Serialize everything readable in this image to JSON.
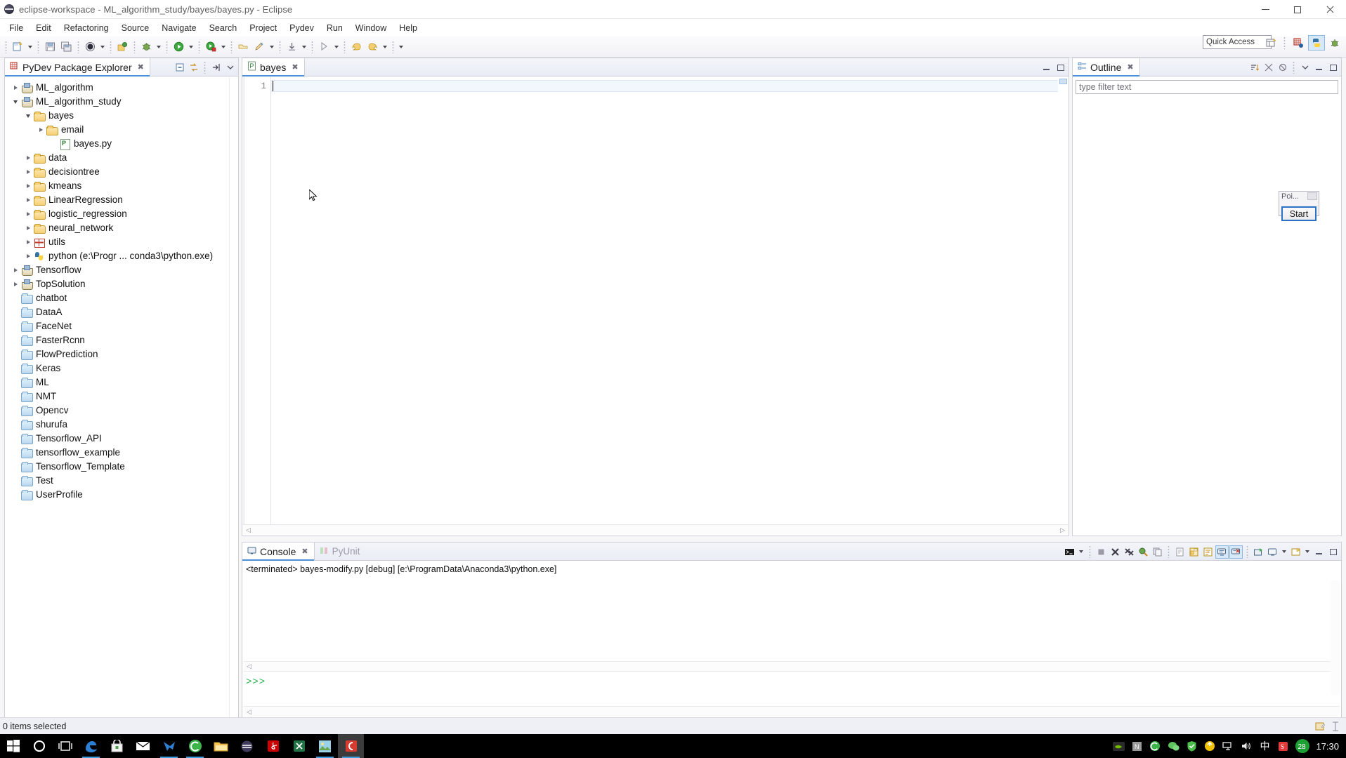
{
  "window": {
    "title": "eclipse-workspace - ML_algorithm_study/bayes/bayes.py - Eclipse",
    "app_icon": "eclipse-icon",
    "minimize": "minimize-icon",
    "maximize": "maximize-icon",
    "close": "close-icon"
  },
  "menubar": {
    "items": [
      {
        "label": "File"
      },
      {
        "label": "Edit"
      },
      {
        "label": "Refactoring"
      },
      {
        "label": "Source"
      },
      {
        "label": "Navigate"
      },
      {
        "label": "Search"
      },
      {
        "label": "Project"
      },
      {
        "label": "Pydev"
      },
      {
        "label": "Run"
      },
      {
        "label": "Window"
      },
      {
        "label": "Help"
      }
    ]
  },
  "toolbar": {
    "quick_access_placeholder": "Quick Access",
    "buttons": [
      {
        "name": "new-wizard-icon"
      },
      {
        "name": "save-icon"
      },
      {
        "name": "save-all-icon"
      },
      {
        "name": "print-icon"
      },
      {
        "name": "debug-icon"
      },
      {
        "name": "external-tools-icon"
      },
      {
        "name": "run-icon"
      },
      {
        "name": "coverage-icon"
      },
      {
        "name": "open-type-icon"
      },
      {
        "name": "pin-editor-icon"
      },
      {
        "name": "previous-annotation-icon"
      },
      {
        "name": "next-annotation-icon"
      },
      {
        "name": "back-icon"
      },
      {
        "name": "forward-icon"
      }
    ],
    "perspective": [
      {
        "name": "open-perspective-icon"
      },
      {
        "name": "java-perspective-icon"
      },
      {
        "name": "pydev-perspective-icon"
      },
      {
        "name": "debug-perspective-icon"
      }
    ]
  },
  "explorer": {
    "title": "PyDev Package Explorer",
    "title_icon": "package-explorer-icon",
    "close_icon": "close-icon",
    "view_tools": [
      {
        "name": "collapse-all-icon"
      },
      {
        "name": "link-with-editor-icon"
      },
      {
        "name": "focus-on-active-task-icon"
      },
      {
        "name": "view-menu-icon"
      }
    ],
    "minimize_icon": "minimize-icon",
    "maximize_icon": "maximize-icon",
    "tree": [
      {
        "label": "ML_algorithm",
        "icon": "project-icon",
        "indent": 0,
        "state": "collapsed"
      },
      {
        "label": "ML_algorithm_study",
        "icon": "project-icon",
        "indent": 0,
        "state": "expanded"
      },
      {
        "label": "bayes",
        "icon": "folder-icon",
        "indent": 1,
        "state": "expanded"
      },
      {
        "label": "email",
        "icon": "folder-icon",
        "indent": 2,
        "state": "collapsed"
      },
      {
        "label": "bayes.py",
        "icon": "python-file-icon",
        "indent": 3,
        "state": "leaf"
      },
      {
        "label": "data",
        "icon": "folder-icon",
        "indent": 1,
        "state": "collapsed"
      },
      {
        "label": "decisiontree",
        "icon": "folder-icon",
        "indent": 1,
        "state": "collapsed"
      },
      {
        "label": "kmeans",
        "icon": "folder-icon",
        "indent": 1,
        "state": "collapsed"
      },
      {
        "label": "LinearRegression",
        "icon": "folder-icon",
        "indent": 1,
        "state": "collapsed"
      },
      {
        "label": "logistic_regression",
        "icon": "folder-icon",
        "indent": 1,
        "state": "collapsed"
      },
      {
        "label": "neural_network",
        "icon": "folder-icon",
        "indent": 1,
        "state": "collapsed"
      },
      {
        "label": "utils",
        "icon": "grid-icon",
        "indent": 1,
        "state": "collapsed"
      },
      {
        "label": "python  (e:\\Progr ... conda3\\python.exe)",
        "icon": "python-interpreter-icon",
        "indent": 1,
        "state": "collapsed"
      },
      {
        "label": "Tensorflow",
        "icon": "project-icon",
        "indent": 0,
        "state": "collapsed"
      },
      {
        "label": "TopSolution",
        "icon": "project-icon",
        "indent": 0,
        "state": "collapsed"
      },
      {
        "label": "chatbot",
        "icon": "closed-folder-icon",
        "indent": 0,
        "state": "leaf"
      },
      {
        "label": "DataA",
        "icon": "closed-folder-icon",
        "indent": 0,
        "state": "leaf"
      },
      {
        "label": "FaceNet",
        "icon": "closed-folder-icon",
        "indent": 0,
        "state": "leaf"
      },
      {
        "label": "FasterRcnn",
        "icon": "closed-folder-icon",
        "indent": 0,
        "state": "leaf"
      },
      {
        "label": "FlowPrediction",
        "icon": "closed-folder-icon",
        "indent": 0,
        "state": "leaf"
      },
      {
        "label": "Keras",
        "icon": "closed-folder-icon",
        "indent": 0,
        "state": "leaf"
      },
      {
        "label": "ML",
        "icon": "closed-folder-icon",
        "indent": 0,
        "state": "leaf"
      },
      {
        "label": "NMT",
        "icon": "closed-folder-icon",
        "indent": 0,
        "state": "leaf"
      },
      {
        "label": "Opencv",
        "icon": "closed-folder-icon",
        "indent": 0,
        "state": "leaf"
      },
      {
        "label": "shurufa",
        "icon": "closed-folder-icon",
        "indent": 0,
        "state": "leaf"
      },
      {
        "label": "Tensorflow_API",
        "icon": "closed-folder-icon",
        "indent": 0,
        "state": "leaf"
      },
      {
        "label": "tensorflow_example",
        "icon": "closed-folder-icon",
        "indent": 0,
        "state": "leaf"
      },
      {
        "label": "Tensorflow_Template",
        "icon": "closed-folder-icon",
        "indent": 0,
        "state": "leaf"
      },
      {
        "label": "Test",
        "icon": "closed-folder-icon",
        "indent": 0,
        "state": "leaf"
      },
      {
        "label": "UserProfile",
        "icon": "closed-folder-icon",
        "indent": 0,
        "state": "leaf"
      }
    ]
  },
  "editor": {
    "tab_label": "bayes",
    "tab_icon": "python-file-icon",
    "tab_close": "close-icon",
    "line_numbers": [
      "1"
    ],
    "content": "",
    "minimize_icon": "minimize-icon",
    "maximize_icon": "maximize-icon"
  },
  "outline": {
    "title": "Outline",
    "title_icon": "outline-icon",
    "close_icon": "close-icon",
    "filter_placeholder": "type filter text",
    "tools": [
      {
        "name": "sort-icon"
      },
      {
        "name": "hide-fields-icon"
      },
      {
        "name": "hide-static-icon"
      },
      {
        "name": "hide-nonpublic-icon"
      },
      {
        "name": "view-menu-icon"
      }
    ],
    "minimize_icon": "minimize-icon",
    "maximize_icon": "maximize-icon"
  },
  "popup": {
    "title": "Poi...",
    "start_label": "Start",
    "close_icon": "close-icon"
  },
  "console": {
    "tabs": [
      {
        "label": "Console",
        "icon": "console-icon",
        "active": true,
        "close": "close-icon"
      },
      {
        "label": "PyUnit",
        "icon": "pyunit-icon",
        "active": false
      }
    ],
    "terminated_line": "<terminated> bayes-modify.py [debug] [e:\\ProgramData\\Anaconda3\\python.exe]",
    "prompt": ">>>",
    "tools": [
      {
        "name": "display-selected-console-icon"
      },
      {
        "name": "terminate-icon"
      },
      {
        "name": "remove-launch-icon"
      },
      {
        "name": "remove-all-terminated-icon"
      },
      {
        "name": "show-console-preferences-icon"
      },
      {
        "name": "clear-console-icon"
      },
      {
        "name": "scroll-lock-icon"
      },
      {
        "name": "pin-console-icon"
      },
      {
        "name": "word-wrap-icon"
      },
      {
        "name": "show-console-on-output-icon"
      },
      {
        "name": "show-console-on-error-icon"
      },
      {
        "name": "open-console-icon"
      },
      {
        "name": "display-selected-console-menu-icon"
      },
      {
        "name": "new-console-view-icon"
      },
      {
        "name": "view-menu-icon"
      }
    ]
  },
  "statusbar": {
    "text": "0 items selected",
    "icons": [
      {
        "name": "writable-indicator-icon"
      },
      {
        "name": "smart-insert-icon"
      }
    ]
  },
  "taskbar": {
    "items": [
      {
        "name": "windows-start-icon",
        "color": "#ffffff"
      },
      {
        "name": "cortana-search-icon",
        "color": "#ffffff"
      },
      {
        "name": "task-view-icon",
        "color": "#ffffff"
      },
      {
        "name": "edge-browser-icon",
        "color": "#2d7fd3"
      },
      {
        "name": "microsoft-store-icon",
        "color": "#f3f3f3"
      },
      {
        "name": "mail-icon",
        "color": "#ffffff"
      },
      {
        "name": "foxmail-icon",
        "color": "#2f7fd0"
      },
      {
        "name": "360-browser-icon",
        "color": "#3bb44a"
      },
      {
        "name": "file-explorer-icon",
        "color": "#f6c453"
      },
      {
        "name": "eclipse-icon",
        "color": "#3f3a5b"
      },
      {
        "name": "adobe-reader-icon",
        "color": "#cc0000"
      },
      {
        "name": "excel-icon",
        "color": "#217346"
      },
      {
        "name": "photos-icon",
        "color": "#9ad0e8"
      },
      {
        "name": "camtasia-icon",
        "color": "#d63b30"
      }
    ],
    "tray": [
      {
        "name": "nvidia-icon",
        "color": "#76b900"
      },
      {
        "name": "nuget-icon",
        "color": "#a5a5a5"
      },
      {
        "name": "360-shield-icon",
        "color": "#3bb44a"
      },
      {
        "name": "wechat-icon",
        "color": "#5ec45e"
      },
      {
        "name": "security-shield-icon",
        "color": "#4bbf4b"
      },
      {
        "name": "power-icon",
        "color": "#f2c200"
      },
      {
        "name": "network-icon",
        "color": "#e6e6e6"
      },
      {
        "name": "volume-icon",
        "color": "#e6e6e6"
      },
      {
        "name": "ime-chinese-icon",
        "color": "#ffffff",
        "glyph": "中"
      },
      {
        "name": "sogou-ime-icon",
        "color": "#e03a3a"
      },
      {
        "name": "battery-badge-icon",
        "color": "#1fa034",
        "glyph": "28"
      }
    ],
    "clock": "17:30"
  }
}
